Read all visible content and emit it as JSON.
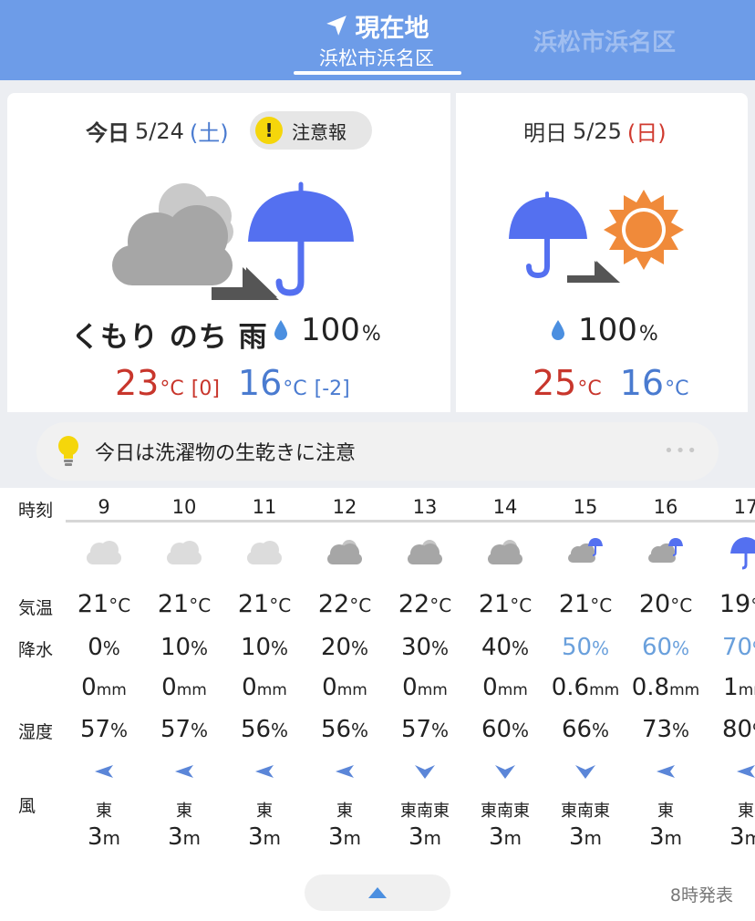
{
  "header": {
    "current_tab_title": "現在地",
    "current_tab_sub": "浜松市浜名区",
    "other_tab": "浜松市浜名区"
  },
  "today": {
    "label": "今日",
    "date": "5/24",
    "dow": "(土)",
    "alert": "注意報",
    "alert_mark": "!",
    "forecast": "くもり のち 雨",
    "pop": "100",
    "pop_unit": "%",
    "high": "23",
    "high_diff": "[0]",
    "low": "16",
    "low_diff": "[-2]",
    "temp_unit": "°C"
  },
  "tomorrow": {
    "label": "明日",
    "date": "5/25",
    "dow": "(日)",
    "pop": "100",
    "pop_unit": "%",
    "high": "25",
    "low": "16",
    "temp_unit": "°C"
  },
  "advice": {
    "text": "今日は洗濯物の生乾きに注意",
    "more": "•••"
  },
  "hourly": {
    "labels": {
      "time": "時刻",
      "temp": "気温",
      "precip": "降水",
      "humidity": "湿度",
      "wind": "風"
    },
    "units": {
      "temp": "°C",
      "pct": "%",
      "mm": "mm",
      "m": "m"
    },
    "cols": [
      {
        "hour": "9",
        "icon": "cloud-light-icon",
        "temp": "21",
        "pop": "0",
        "amt": "0",
        "hum": "57",
        "dir": "東",
        "spd": "3"
      },
      {
        "hour": "10",
        "icon": "cloud-light-icon",
        "temp": "21",
        "pop": "10",
        "amt": "0",
        "hum": "57",
        "dir": "東",
        "spd": "3"
      },
      {
        "hour": "11",
        "icon": "cloud-light-icon",
        "temp": "21",
        "pop": "10",
        "amt": "0",
        "hum": "56",
        "dir": "東",
        "spd": "3"
      },
      {
        "hour": "12",
        "icon": "cloud-icon",
        "temp": "22",
        "pop": "20",
        "amt": "0",
        "hum": "56",
        "dir": "東",
        "spd": "3"
      },
      {
        "hour": "13",
        "icon": "cloud-icon",
        "temp": "22",
        "pop": "30",
        "amt": "0",
        "hum": "57",
        "dir": "東南東",
        "spd": "3"
      },
      {
        "hour": "14",
        "icon": "cloud-icon",
        "temp": "21",
        "pop": "40",
        "amt": "0",
        "hum": "60",
        "dir": "東南東",
        "spd": "3"
      },
      {
        "hour": "15",
        "icon": "cloud-rain-icon",
        "temp": "21",
        "pop": "50",
        "amt": "0.6",
        "hum": "66",
        "dir": "東南東",
        "spd": "3"
      },
      {
        "hour": "16",
        "icon": "cloud-rain-icon",
        "temp": "20",
        "pop": "60",
        "amt": "0.8",
        "hum": "73",
        "dir": "東",
        "spd": "3"
      },
      {
        "hour": "17",
        "icon": "umbrella-icon",
        "temp": "19",
        "pop": "70",
        "amt": "1",
        "hum": "80",
        "dir": "東",
        "spd": "3"
      }
    ]
  },
  "footer": {
    "issued": "8時発表"
  },
  "colors": {
    "header": "#6d9ce8",
    "high_temp": "#c8362c",
    "low_temp": "#4a7bd0",
    "accent_blue": "#5470f0",
    "sun_orange": "#f08a3a",
    "pop_highlight": "#6aa0dc"
  }
}
